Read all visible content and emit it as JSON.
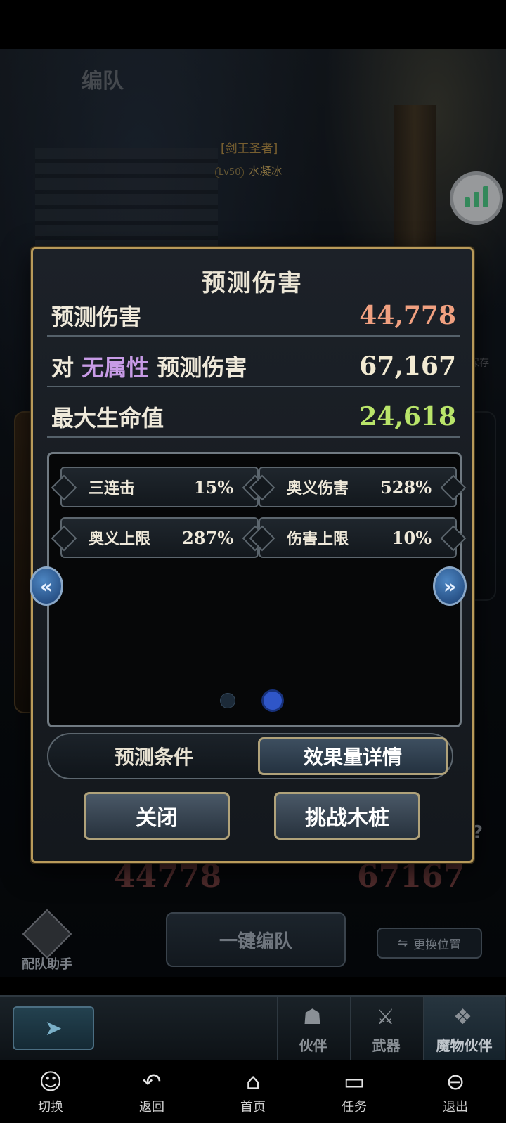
{
  "scene": {
    "title": "编队",
    "npc_title": "[剑王圣者]",
    "npc_level": "Lv50",
    "npc_name": "水凝冰",
    "save_label": "保存"
  },
  "modal": {
    "title": "预测伤害",
    "rows": [
      {
        "label": "预测伤害",
        "value": "44,778",
        "color": "#f0a080"
      },
      {
        "label_prefix": "对",
        "label_attr": "无属性",
        "label_suffix": "预测伤害",
        "value": "67,167",
        "color": "#f2ead2"
      },
      {
        "label": "最大生命值",
        "value": "24,618",
        "color": "#b9e46a"
      }
    ],
    "chips": [
      {
        "name": "三连击",
        "value": "15%"
      },
      {
        "name": "奥义伤害",
        "value": "528%"
      },
      {
        "name": "奥义上限",
        "value": "287%"
      },
      {
        "name": "伤害上限",
        "value": "10%"
      }
    ],
    "page_count": 2,
    "current_page": 2,
    "toggle": {
      "left": "预测条件",
      "right": "效果量详情",
      "selected": "right"
    },
    "close_label": "关闭",
    "challenge_label": "挑战木桩"
  },
  "behind": {
    "damage_left": "44778",
    "damage_right": "67167",
    "question": "?",
    "one_key_label": "一键编队",
    "swap_label": "更换位置",
    "assistant_label": "配队助手"
  },
  "tabs": [
    {
      "label": "伙伴",
      "icon": "companion-icon"
    },
    {
      "label": "武器",
      "icon": "weapon-icon"
    },
    {
      "label": "魔物伙伴",
      "icon": "monster-icon"
    }
  ],
  "system_nav": [
    {
      "label": "切换",
      "icon": "switch-icon"
    },
    {
      "label": "返回",
      "icon": "back-icon"
    },
    {
      "label": "首页",
      "icon": "home-icon"
    },
    {
      "label": "任务",
      "icon": "tasks-icon"
    },
    {
      "label": "退出",
      "icon": "exit-icon"
    }
  ],
  "colors": {
    "accent_gold": "#b89a5a",
    "attr_purple": "#c79be6",
    "hp_green": "#b9e46a",
    "damage_orange": "#f0a080",
    "page_dot_active": "#2f56c8"
  }
}
